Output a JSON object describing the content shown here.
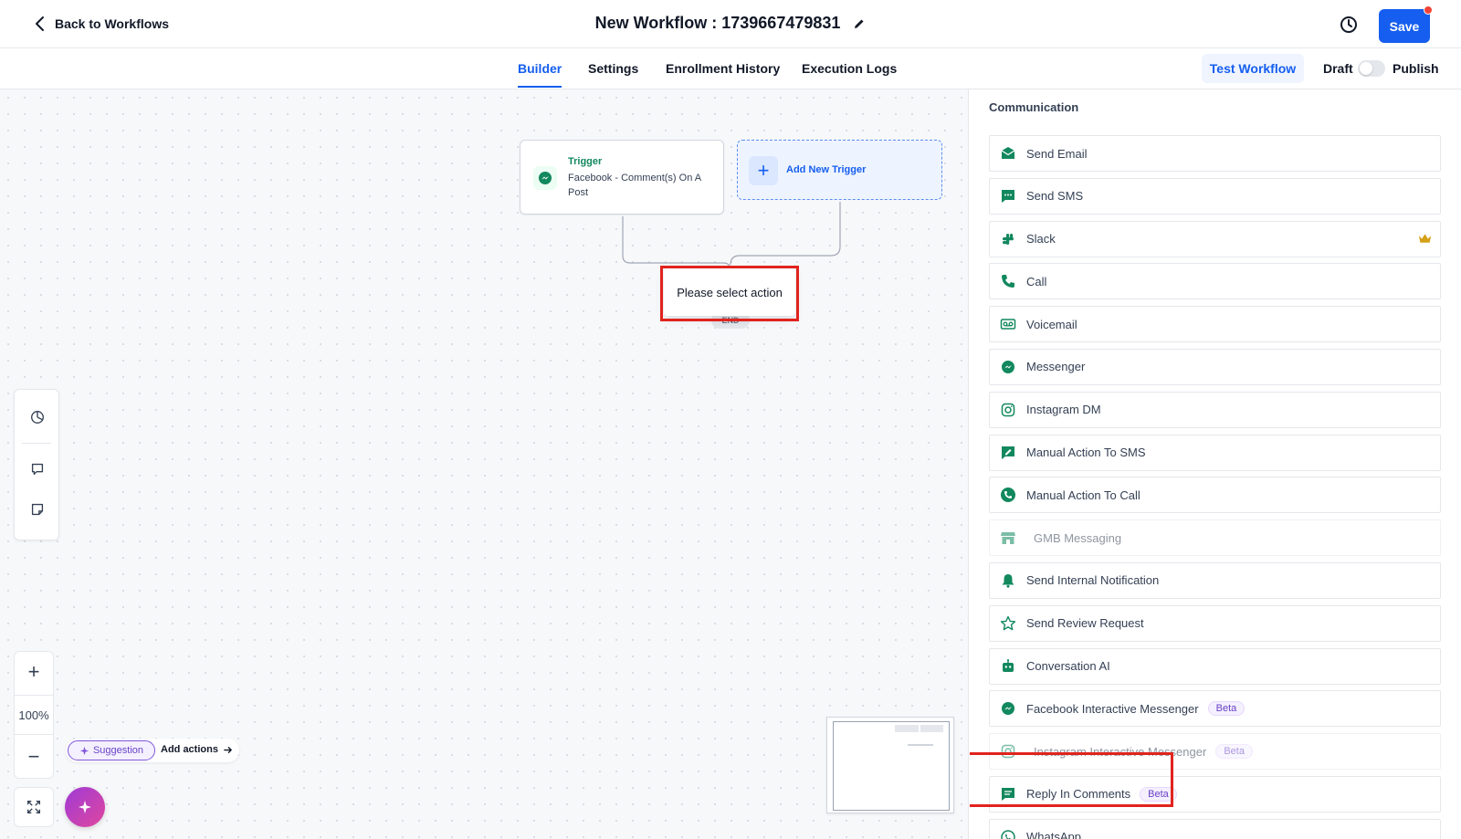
{
  "header": {
    "back_label": "Back to Workflows",
    "title": "New Workflow : 1739667479831",
    "save_label": "Save"
  },
  "tabs": [
    {
      "label": "Builder",
      "active": true
    },
    {
      "label": "Settings",
      "active": false
    },
    {
      "label": "Enrollment History",
      "active": false
    },
    {
      "label": "Execution Logs",
      "active": false
    }
  ],
  "actions": {
    "test_label": "Test Workflow",
    "draft_label": "Draft",
    "publish_label": "Publish",
    "published": false
  },
  "canvas": {
    "trigger": {
      "kicker": "Trigger",
      "description": "Facebook - Comment(s) On A Post",
      "icon": "messenger-icon"
    },
    "add_trigger_label": "Add New Trigger",
    "end_label": "END",
    "popup_text": "Please select action",
    "zoom_label": "100%",
    "suggestion_label": "Suggestion",
    "add_actions_label": "Add actions"
  },
  "panel": {
    "section_title": "Communication",
    "items": [
      {
        "label": "Send Email",
        "icon": "email-icon"
      },
      {
        "label": "Send SMS",
        "icon": "sms-icon"
      },
      {
        "label": "Slack",
        "icon": "slack-icon",
        "premium": true
      },
      {
        "label": "Call",
        "icon": "phone-icon"
      },
      {
        "label": "Voicemail",
        "icon": "voicemail-icon"
      },
      {
        "label": "Messenger",
        "icon": "messenger-icon"
      },
      {
        "label": "Instagram DM",
        "icon": "instagram-icon"
      },
      {
        "label": "Manual Action To SMS",
        "icon": "manual-sms-icon"
      },
      {
        "label": "Manual Action To Call",
        "icon": "manual-call-icon"
      },
      {
        "label": "GMB Messaging",
        "icon": "store-icon",
        "disabled": true
      },
      {
        "label": "Send Internal Notification",
        "icon": "bell-icon"
      },
      {
        "label": "Send Review Request",
        "icon": "star-icon"
      },
      {
        "label": "Conversation AI",
        "icon": "robot-icon"
      },
      {
        "label": "Facebook Interactive Messenger",
        "icon": "messenger-icon",
        "badge": "Beta"
      },
      {
        "label": "Instagram Interactive Messenger",
        "icon": "instagram-icon",
        "badge": "Beta",
        "disabled": true
      },
      {
        "label": "Reply In Comments",
        "icon": "comment-icon",
        "badge": "Beta"
      },
      {
        "label": "WhatsApp",
        "icon": "whatsapp-icon"
      }
    ]
  },
  "colors": {
    "primary": "#155eef",
    "icon_green": "#12885e",
    "highlight": "#e1231d",
    "beta": "#6941c6"
  }
}
